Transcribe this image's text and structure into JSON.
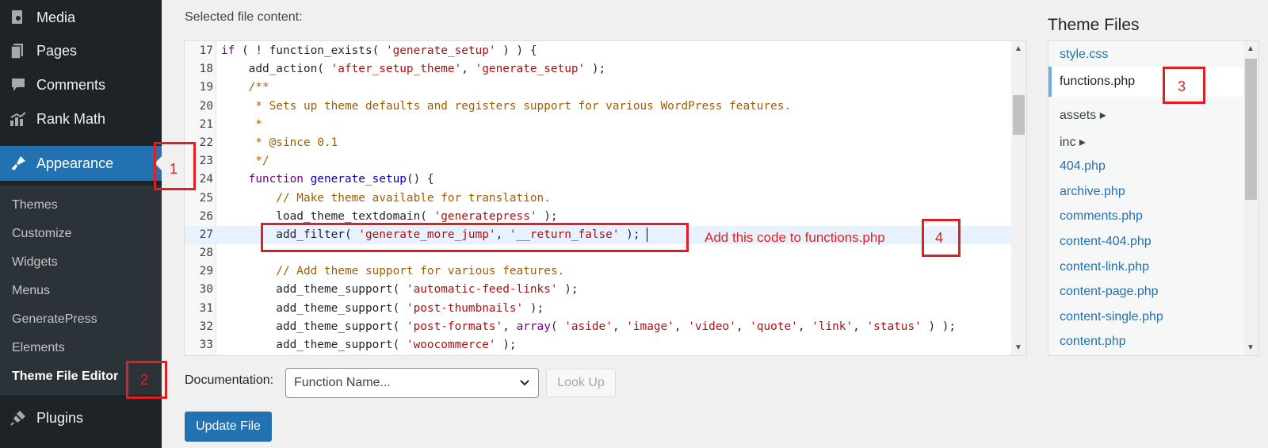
{
  "sidebar": {
    "menu": [
      {
        "label": "Media",
        "icon": "media-icon"
      },
      {
        "label": "Pages",
        "icon": "pages-icon"
      },
      {
        "label": "Comments",
        "icon": "comments-icon"
      },
      {
        "label": "Rank Math",
        "icon": "rank-math-icon"
      },
      {
        "label": "Appearance",
        "icon": "paintbrush-icon"
      },
      {
        "label": "Plugins",
        "icon": "plugins-icon"
      }
    ],
    "submenu": [
      "Themes",
      "Customize",
      "Widgets",
      "Menus",
      "GeneratePress",
      "Elements",
      "Theme File Editor"
    ]
  },
  "editor": {
    "section_label": "Selected file content:",
    "lines": [
      {
        "n": "17",
        "html": "<span class=\"kw\">if</span> ( ! function_exists( <span class=\"str\">'generate_setup'</span> ) ) {"
      },
      {
        "n": "18",
        "html": "    add_action( <span class=\"str\">'after_setup_theme'</span>, <span class=\"str\">'generate_setup'</span> );"
      },
      {
        "n": "19",
        "html": "    <span class=\"cm\">/**</span>"
      },
      {
        "n": "20",
        "html": "<span class=\"cm\">     * Sets up theme defaults and registers support for various WordPress features.</span>"
      },
      {
        "n": "21",
        "html": "<span class=\"cm\">     *</span>"
      },
      {
        "n": "22",
        "html": "<span class=\"cm\">     * @since 0.1</span>"
      },
      {
        "n": "23",
        "html": "<span class=\"cm\">     */</span>"
      },
      {
        "n": "24",
        "html": "    <span class=\"kw\">function</span> <span class=\"fn\">generate_setup</span>() {"
      },
      {
        "n": "25",
        "html": "<span class=\"cm\">        // Make theme available for translation.</span>"
      },
      {
        "n": "26",
        "html": "        load_theme_textdomain( <span class=\"str\">'generatepress'</span> );"
      },
      {
        "n": "27",
        "html": "        add_filter( <span class=\"str\">'generate_more_jump'</span>, <span class=\"str\">'__return_false'</span> );<span class=\"cursor\"></span>"
      },
      {
        "n": "28",
        "html": ""
      },
      {
        "n": "29",
        "html": "<span class=\"cm\">        // Add theme support for various features.</span>"
      },
      {
        "n": "30",
        "html": "        add_theme_support( <span class=\"str\">'automatic-feed-links'</span> );"
      },
      {
        "n": "31",
        "html": "        add_theme_support( <span class=\"str\">'post-thumbnails'</span> );"
      },
      {
        "n": "32",
        "html": "        add_theme_support( <span class=\"str\">'post-formats'</span>, <span class=\"kw\">array</span>( <span class=\"str\">'aside'</span>, <span class=\"str\">'image'</span>, <span class=\"str\">'video'</span>, <span class=\"str\">'quote'</span>, <span class=\"str\">'link'</span>, <span class=\"str\">'status'</span> ) );"
      },
      {
        "n": "33",
        "html": "        add_theme_support( <span class=\"str\">'woocommerce'</span> );"
      }
    ]
  },
  "theme_files": {
    "title": "Theme Files",
    "items": [
      {
        "label": "style.css",
        "type": "file"
      },
      {
        "label": "functions.php",
        "type": "current"
      },
      {
        "label": "assets ▸",
        "type": "folder"
      },
      {
        "label": "inc ▸",
        "type": "folder"
      },
      {
        "label": "404.php",
        "type": "file"
      },
      {
        "label": "archive.php",
        "type": "file"
      },
      {
        "label": "comments.php",
        "type": "file"
      },
      {
        "label": "content-404.php",
        "type": "file"
      },
      {
        "label": "content-link.php",
        "type": "file"
      },
      {
        "label": "content-page.php",
        "type": "file"
      },
      {
        "label": "content-single.php",
        "type": "file"
      },
      {
        "label": "content.php",
        "type": "file"
      }
    ]
  },
  "documentation": {
    "label": "Documentation:",
    "select_value": "Function Name...",
    "lookup_label": "Look Up"
  },
  "update_label": "Update File",
  "annotations": {
    "n1": "1",
    "n2": "2",
    "n3": "3",
    "n4": "4",
    "note": "Add this code to functions.php"
  },
  "colors": {
    "sidebar_bg": "#1d2327",
    "accent": "#2271b1",
    "annotation": "#e02020"
  }
}
